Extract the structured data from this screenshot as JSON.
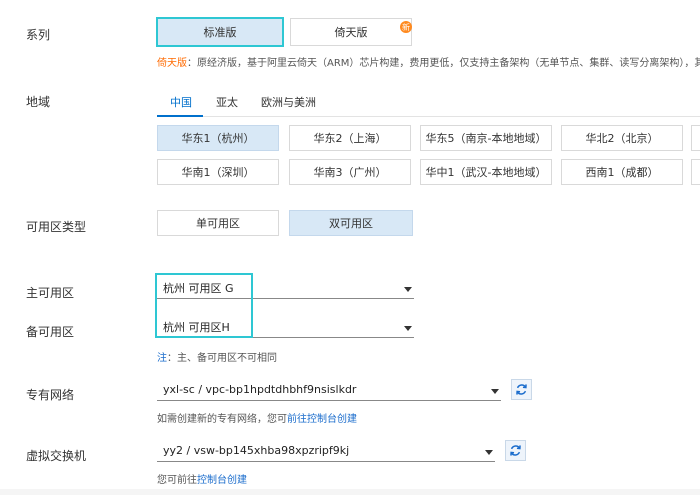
{
  "labels": {
    "series": "系列",
    "region": "地域",
    "zone_type": "可用区类型",
    "primary_zone": "主可用区",
    "secondary_zone": "备可用区",
    "vpc": "专有网络",
    "vswitch": "虚拟交换机"
  },
  "series_options": {
    "standard": "标准版",
    "yitian": "倚天版",
    "new_badge": "新"
  },
  "series_note": {
    "prefix": "倚天版",
    "text": "：原经济版，基于阿里云倚天（ARM）芯片构建，费用更低，仅支持主备架构（无单节点、集群、读写分离架构），其"
  },
  "region_tabs": [
    "中国",
    "亚太",
    "欧洲与美洲"
  ],
  "regions_row1": [
    "华东1（杭州）",
    "华东2（上海）",
    "华东5（南京-本地地域）",
    "华北2（北京）"
  ],
  "regions_row2": [
    "华南1（深圳）",
    "华南3（广州）",
    "华中1（武汉-本地地域）",
    "西南1（成都）"
  ],
  "zone_types": [
    "单可用区",
    "双可用区"
  ],
  "primary_zone_value": "杭州 可用区 G",
  "secondary_zone_value": "杭州 可用区H",
  "zone_note": {
    "prefix": "注",
    "text": "：主、备可用区不可相同"
  },
  "vpc_value": "yxl-sc / vpc-bp1hpdtdhbhf9nsislkdr",
  "vpc_note": {
    "text": "如需创建新的专有网络，您可",
    "link": "前往控制台创建"
  },
  "vswitch_value": "yy2 / vsw-bp145xhba98xpzripf9kj",
  "vswitch_note": {
    "text": "您可前往",
    "link": "控制台创建"
  },
  "colors": {
    "highlight": "#2ec7d3",
    "selected_bg": "#d8e8f6",
    "link": "#1a6ccc",
    "orange": "#ff6a00",
    "active_tab": "#0070cc"
  }
}
